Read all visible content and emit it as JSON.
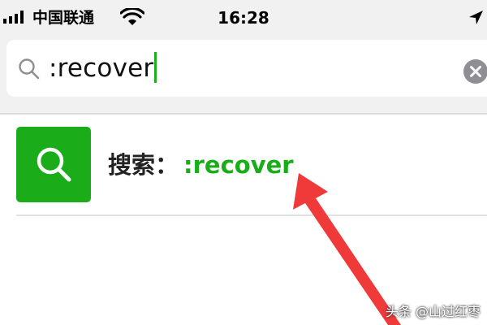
{
  "status_bar": {
    "carrier": "中国联通",
    "time": "16:28",
    "icons": [
      "signal-bars-icon",
      "wifi-icon",
      "location-arrow-icon"
    ]
  },
  "search": {
    "value": ":recover",
    "icons": [
      "search-icon",
      "clear-icon"
    ]
  },
  "result": {
    "prefix": "搜索：",
    "query": ":recover",
    "icon": "search-icon"
  },
  "annotation": {
    "icon": "red-arrow-icon",
    "color": "#f03a3a"
  },
  "watermark": {
    "text": "头条 @山过红枣"
  },
  "colors": {
    "accent": "#1aad19",
    "background": "#f1f1f1",
    "arrow": "#f03a3a"
  }
}
